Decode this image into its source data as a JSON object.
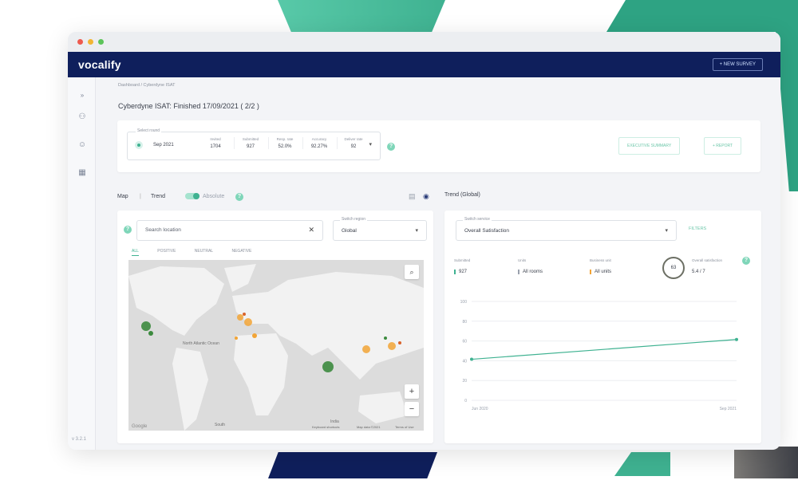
{
  "app": {
    "logo": "vocalify",
    "new_survey": "+ NEW SURVEY",
    "version": "v 3.2.1"
  },
  "breadcrumb": {
    "root": "Dashboard",
    "sep": "/",
    "current": "Cyberdyne ISAT"
  },
  "page_title": "Cyberdyne ISAT: Finished 17/09/2021 ( 2/2 )",
  "survey": {
    "label": "Select round",
    "round": "Sep 2021",
    "stats": [
      {
        "label": "Invited",
        "value": "1704"
      },
      {
        "label": "Submitted",
        "value": "927"
      },
      {
        "label": "Resp. rate",
        "value": "52.0%"
      },
      {
        "label": "Accuracy",
        "value": "92.27%"
      },
      {
        "label": "Deliver rate",
        "value": "92"
      }
    ],
    "execute_button": "EXECUTIVE SUMMARY",
    "report_button": "+ REPORT"
  },
  "map_panel": {
    "tab_map": "Map",
    "tab_sep": "|",
    "tab_trend": "Trend",
    "absolute": "Absolute",
    "search_placeholder": "Search location",
    "region_label": "Switch region",
    "region_value": "Global",
    "filters": [
      "ALL",
      "POSITIVE",
      "NEUTRAL",
      "NEGATIVE"
    ],
    "labels": [
      "North Atlantic Ocean",
      "India",
      "South"
    ],
    "footer": [
      "Keyboard shortcuts",
      "Map data ©2021",
      "Terms of Use"
    ],
    "zoom_in": "+",
    "zoom_out": "−",
    "google": "Google"
  },
  "trend_panel": {
    "title": "Trend (Global)",
    "service_label": "Switch service",
    "service_value": "Overall Satisfaction",
    "filter": "FILTERS",
    "metrics": [
      {
        "label": "Submitted",
        "value": "927"
      },
      {
        "label": "Units",
        "value": "All rooms"
      },
      {
        "label": "Business unit",
        "value": "All units"
      }
    ],
    "gauge": "63",
    "overall_label": "Overall satisfaction",
    "overall_value": "5.4 / 7"
  },
  "chart_data": {
    "type": "line",
    "x": [
      "Jun 2020",
      "Sep 2021"
    ],
    "series": [
      {
        "values": [
          41.5,
          61.5
        ]
      }
    ],
    "yticks": [
      0,
      20,
      40,
      60,
      80,
      100
    ],
    "ylim": [
      0,
      100
    ],
    "color": "#3fb291",
    "grid": true
  }
}
